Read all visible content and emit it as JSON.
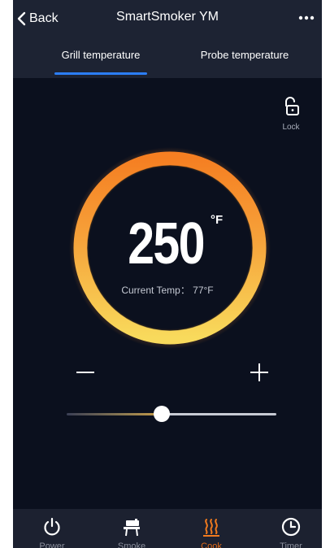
{
  "nav": {
    "back_label": "Back",
    "title": "SmartSmoker YM",
    "more_icon": "ellipsis-icon"
  },
  "tabs": [
    {
      "label": "Grill temperature",
      "active": true
    },
    {
      "label": "Probe temperature",
      "active": false
    }
  ],
  "lock": {
    "label": "Lock",
    "icon": "unlock-icon"
  },
  "dial": {
    "set_temp": "250",
    "unit": "°F",
    "current_temp": "Current Temp： 77°F"
  },
  "controls": {
    "minus": "−",
    "plus": "+"
  },
  "slider": {
    "level": 0.45
  },
  "bottom_nav": [
    {
      "label": "Power",
      "icon": "power-icon",
      "active": false
    },
    {
      "label": "Smoke",
      "icon": "smoker-icon",
      "active": false
    },
    {
      "label": "Cook",
      "icon": "heat-icon",
      "active": true
    },
    {
      "label": "Timer",
      "icon": "clock-icon",
      "active": false
    }
  ],
  "colors": {
    "background": "#0b101e",
    "header": "#1d2333",
    "accent_blue": "#2c7ef8",
    "accent_orange": "#f07a1e",
    "ring_yellow": "#f7d25a"
  }
}
